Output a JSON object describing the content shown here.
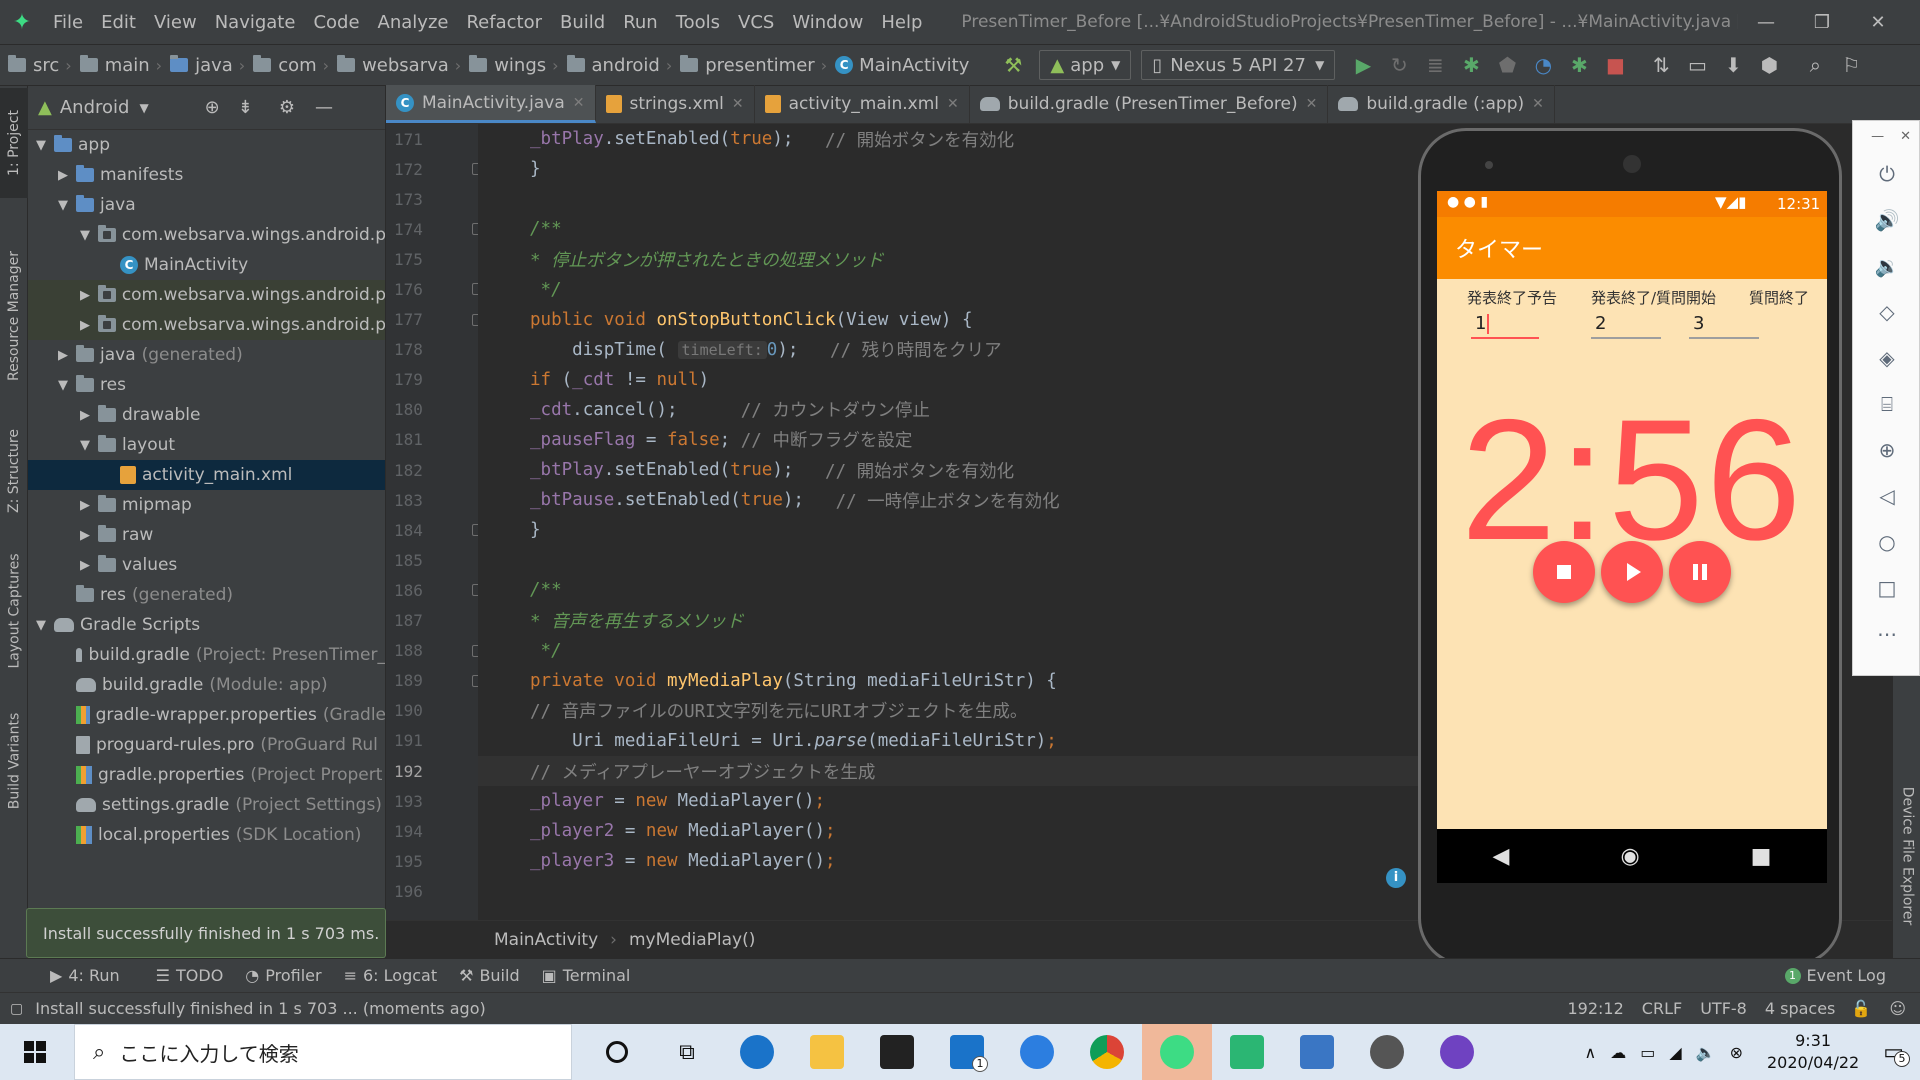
{
  "menu": {
    "items": [
      "File",
      "Edit",
      "View",
      "Navigate",
      "Code",
      "Analyze",
      "Refactor",
      "Build",
      "Run",
      "Tools",
      "VCS",
      "Window",
      "Help"
    ],
    "title": "PresenTimer_Before [...¥AndroidStudioProjects¥PresenTimer_Before] - ...¥MainActivity.java [app]"
  },
  "nav": {
    "crumbs": [
      "src",
      "main",
      "java",
      "com",
      "websarva",
      "wings",
      "android",
      "presentimer"
    ],
    "class_crumb": "MainActivity",
    "run_config": "app",
    "device": "Nexus 5 API 27"
  },
  "project": {
    "view": "Android",
    "tree": [
      {
        "label": "app",
        "extra": ""
      },
      {
        "label": "manifests",
        "extra": ""
      },
      {
        "label": "java",
        "extra": ""
      },
      {
        "label": "com.websarva.wings.android.p",
        "extra": ""
      },
      {
        "label": "MainActivity",
        "extra": ""
      },
      {
        "label": "com.websarva.wings.android.p",
        "extra": ""
      },
      {
        "label": "com.websarva.wings.android.p",
        "extra": ""
      },
      {
        "label": "java",
        "extra": "(generated)"
      },
      {
        "label": "res",
        "extra": ""
      },
      {
        "label": "drawable",
        "extra": ""
      },
      {
        "label": "layout",
        "extra": ""
      },
      {
        "label": "activity_main.xml",
        "extra": ""
      },
      {
        "label": "mipmap",
        "extra": ""
      },
      {
        "label": "raw",
        "extra": ""
      },
      {
        "label": "values",
        "extra": ""
      },
      {
        "label": "res",
        "extra": "(generated)"
      },
      {
        "label": "Gradle Scripts",
        "extra": ""
      },
      {
        "label": "build.gradle",
        "extra": "(Project: PresenTimer_"
      },
      {
        "label": "build.gradle",
        "extra": "(Module: app)"
      },
      {
        "label": "gradle-wrapper.properties",
        "extra": "(Gradle"
      },
      {
        "label": "proguard-rules.pro",
        "extra": "(ProGuard Rul"
      },
      {
        "label": "gradle.properties",
        "extra": "(Project Propert"
      },
      {
        "label": "settings.gradle",
        "extra": "(Project Settings)"
      },
      {
        "label": "local.properties",
        "extra": "(SDK Location)"
      }
    ]
  },
  "side_tabs": {
    "project": "1: Project",
    "resource": "Resource Manager",
    "structure": "Z: Structure",
    "captures": "Layout Captures",
    "variants": "Build Variants",
    "device_explorer": "Device File Explorer"
  },
  "tabs": [
    {
      "label": "MainActivity.java"
    },
    {
      "label": "strings.xml"
    },
    {
      "label": "activity_main.xml"
    },
    {
      "label": "build.gradle (PresenTimer_Before)"
    },
    {
      "label": "build.gradle (:app)"
    }
  ],
  "code": {
    "line_numbers": [
      "171",
      "172",
      "173",
      "174",
      "175",
      "176",
      "177",
      "178",
      "179",
      "180",
      "181",
      "182",
      "183",
      "184",
      "185",
      "186",
      "187",
      "188",
      "189",
      "190",
      "191",
      "192",
      "193",
      "194",
      "195",
      "196"
    ],
    "l171": "_btPlay.setEnabled(true);   // 開始ボタンを有効化",
    "l175": "* 停止ボタンが押されたときの処理メソッド",
    "l178_hint": "timeLeft:",
    "l178_comment": "// 残り時間をクリア",
    "l180_comment": "// カウントダウン停止",
    "l181_comment": "// 中断フラグを設定",
    "l182_comment": "// 開始ボタンを有効化",
    "l183_comment": "// 一時停止ボタンを有効化",
    "l187": "* 音声を再生するメソッド",
    "l190": "// 音声ファイルのURI文字列を元にURIオブジェクトを生成。",
    "l192": "// メディアプレーヤーオブジェクトを生成"
  },
  "editor_breadcrumb": {
    "class": "MainActivity",
    "method": "myMediaPlay()"
  },
  "emulator": {
    "time": "12:31",
    "app_title": "タイマー",
    "labels": [
      "発表終了予告",
      "発表終了/質問開始",
      "質問終了"
    ],
    "values": [
      "1",
      "2",
      "3"
    ],
    "timer": "2:56"
  },
  "bottom_tools": [
    "4: Run",
    "TODO",
    "Profiler",
    "6: Logcat",
    "Build",
    "Terminal"
  ],
  "event_log": "Event Log",
  "event_count": "1",
  "balloon": "Install successfully finished in 1 s 703 ms.",
  "status": {
    "message": "Install successfully finished in 1 s 703 ... (moments ago)",
    "position": "192:12",
    "line_sep": "CRLF",
    "encoding": "UTF-8",
    "indent": "4 spaces"
  },
  "taskbar": {
    "search_placeholder": "ここに入力して検索",
    "time": "9:31",
    "date": "2020/04/22",
    "mail_badge": "1",
    "notif_count": "5"
  },
  "colors": {
    "accent": "#fb8c00",
    "timer": "#ff5252",
    "selection": "#0d293e"
  }
}
